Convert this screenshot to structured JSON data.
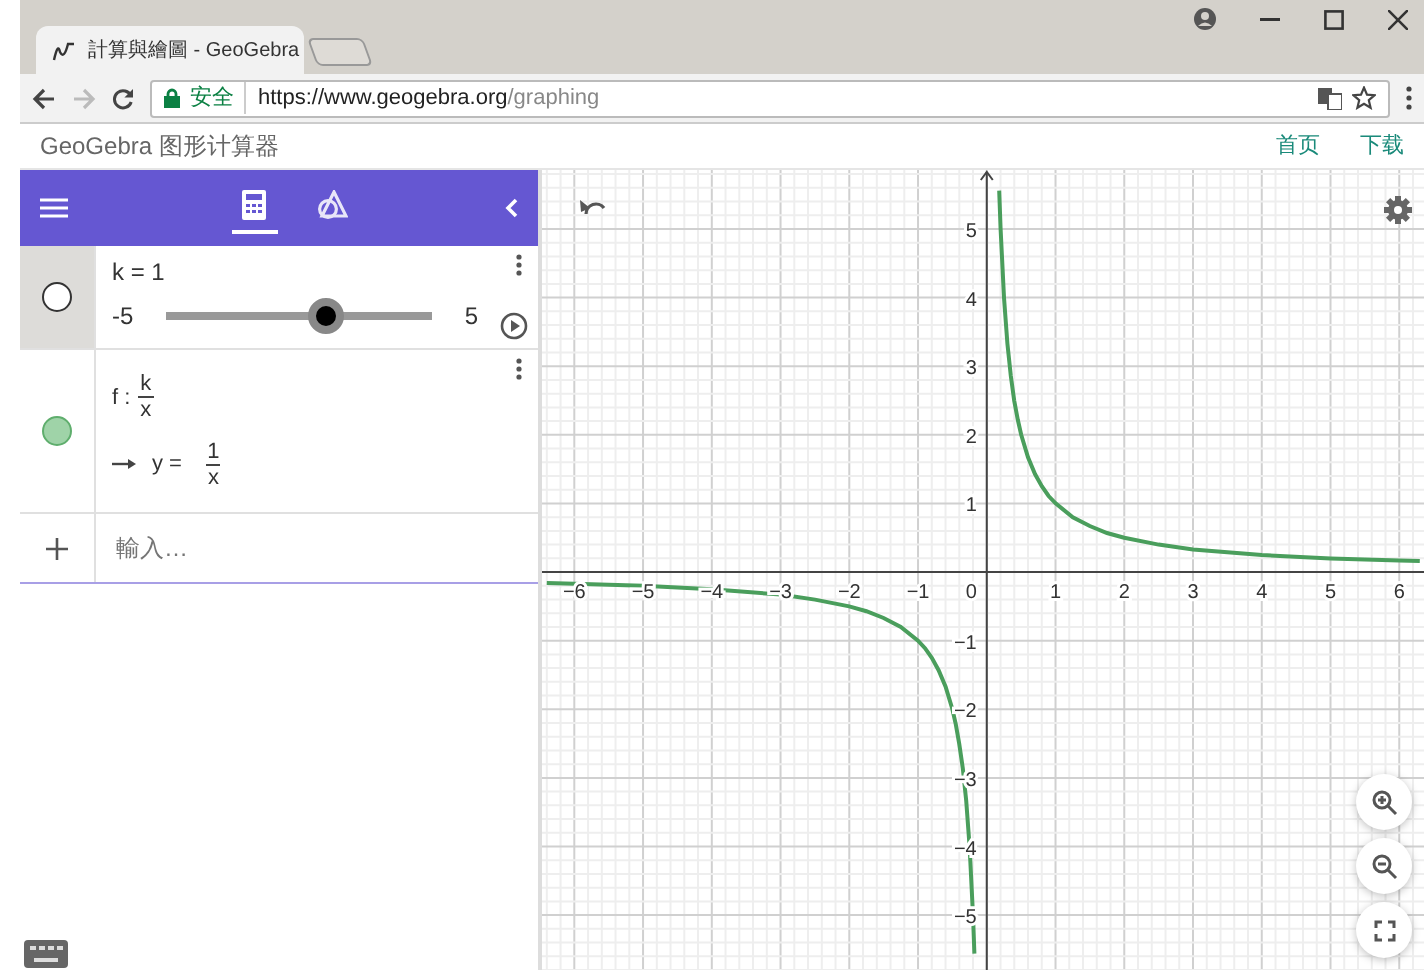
{
  "browser": {
    "tab": {
      "title": "計算與繪圖 - GeoGebra"
    },
    "address": {
      "security": "安全",
      "url_host": "https://www.geogebra.org",
      "url_path": "/graphing"
    }
  },
  "site_header": {
    "title": "GeoGebra 图形计算器",
    "links": [
      {
        "label": "首页"
      },
      {
        "label": "下载"
      }
    ]
  },
  "toolbar": {
    "tabs": [
      {
        "kind": "algebra",
        "selected": true
      },
      {
        "kind": "tools",
        "selected": false
      }
    ]
  },
  "algebra": [
    {
      "kind": "slider",
      "selected": true,
      "visible": false,
      "label": "k = 1",
      "min": "-5",
      "max": "5",
      "level": 0.6
    },
    {
      "kind": "function",
      "selected": false,
      "visible": true,
      "definition": {
        "lhs": "f :",
        "numerator": "k",
        "denominator": "x"
      },
      "output": {
        "lhs": "y =",
        "numerator": "1",
        "denominator": "x"
      }
    },
    {
      "kind": "input",
      "placeholder": "輸入…"
    }
  ],
  "graph": {
    "origin_label": "0",
    "chart_data": {
      "type": "line",
      "grid": true,
      "xlim": [
        -6.47,
        6.36
      ],
      "ylim": [
        -5.8,
        5.86
      ],
      "xticks": [
        {
          "value": -6,
          "label": "−6"
        },
        {
          "value": -5,
          "label": "−5"
        },
        {
          "value": -4,
          "label": "−4"
        },
        {
          "value": -3,
          "label": "−3"
        },
        {
          "value": -2,
          "label": "−2"
        },
        {
          "value": -1,
          "label": "−1"
        },
        {
          "value": 1,
          "label": "1"
        },
        {
          "value": 2,
          "label": "2"
        },
        {
          "value": 3,
          "label": "3"
        },
        {
          "value": 4,
          "label": "4"
        },
        {
          "value": 5,
          "label": "5"
        },
        {
          "value": 6,
          "label": "6"
        }
      ],
      "yticks": [
        {
          "value": -5,
          "label": "−5"
        },
        {
          "value": -4,
          "label": "−4"
        },
        {
          "value": -3,
          "label": "−3"
        },
        {
          "value": -2,
          "label": "−2"
        },
        {
          "value": -1,
          "label": "−1"
        },
        {
          "value": 1,
          "label": "1"
        },
        {
          "value": 2,
          "label": "2"
        },
        {
          "value": 3,
          "label": "3"
        },
        {
          "value": 4,
          "label": "4"
        },
        {
          "value": 5,
          "label": "5"
        }
      ],
      "x": [
        -6.4,
        -6,
        -5,
        -4,
        -3,
        -2.5,
        -2,
        -1.75,
        -1.5,
        -1.25,
        -1,
        -0.9,
        -0.8,
        -0.7,
        -0.6,
        -0.5,
        -0.45,
        -0.4,
        -0.35,
        -0.3,
        -0.25,
        -0.2,
        -0.18,
        0,
        0.18,
        0.2,
        0.25,
        0.3,
        0.35,
        0.4,
        0.45,
        0.5,
        0.6,
        0.7,
        0.8,
        0.9,
        1,
        1.25,
        1.5,
        1.75,
        2,
        2.5,
        3,
        4,
        5,
        6,
        6.3
      ],
      "series": [
        {
          "color": "#4a9e5c",
          "values": [
            -0.16,
            -0.17,
            -0.2,
            -0.25,
            -0.33,
            -0.4,
            -0.5,
            -0.57,
            -0.67,
            -0.8,
            -1,
            -1.11,
            -1.25,
            -1.43,
            -1.67,
            -2,
            -2.22,
            -2.5,
            -2.86,
            -3.33,
            -4,
            -5,
            -5.56,
            null,
            5.56,
            5,
            4,
            3.33,
            2.86,
            2.5,
            2.22,
            2,
            1.67,
            1.43,
            1.25,
            1.11,
            1,
            0.8,
            0.67,
            0.57,
            0.5,
            0.4,
            0.33,
            0.25,
            0.2,
            0.17,
            0.16
          ]
        }
      ]
    }
  }
}
